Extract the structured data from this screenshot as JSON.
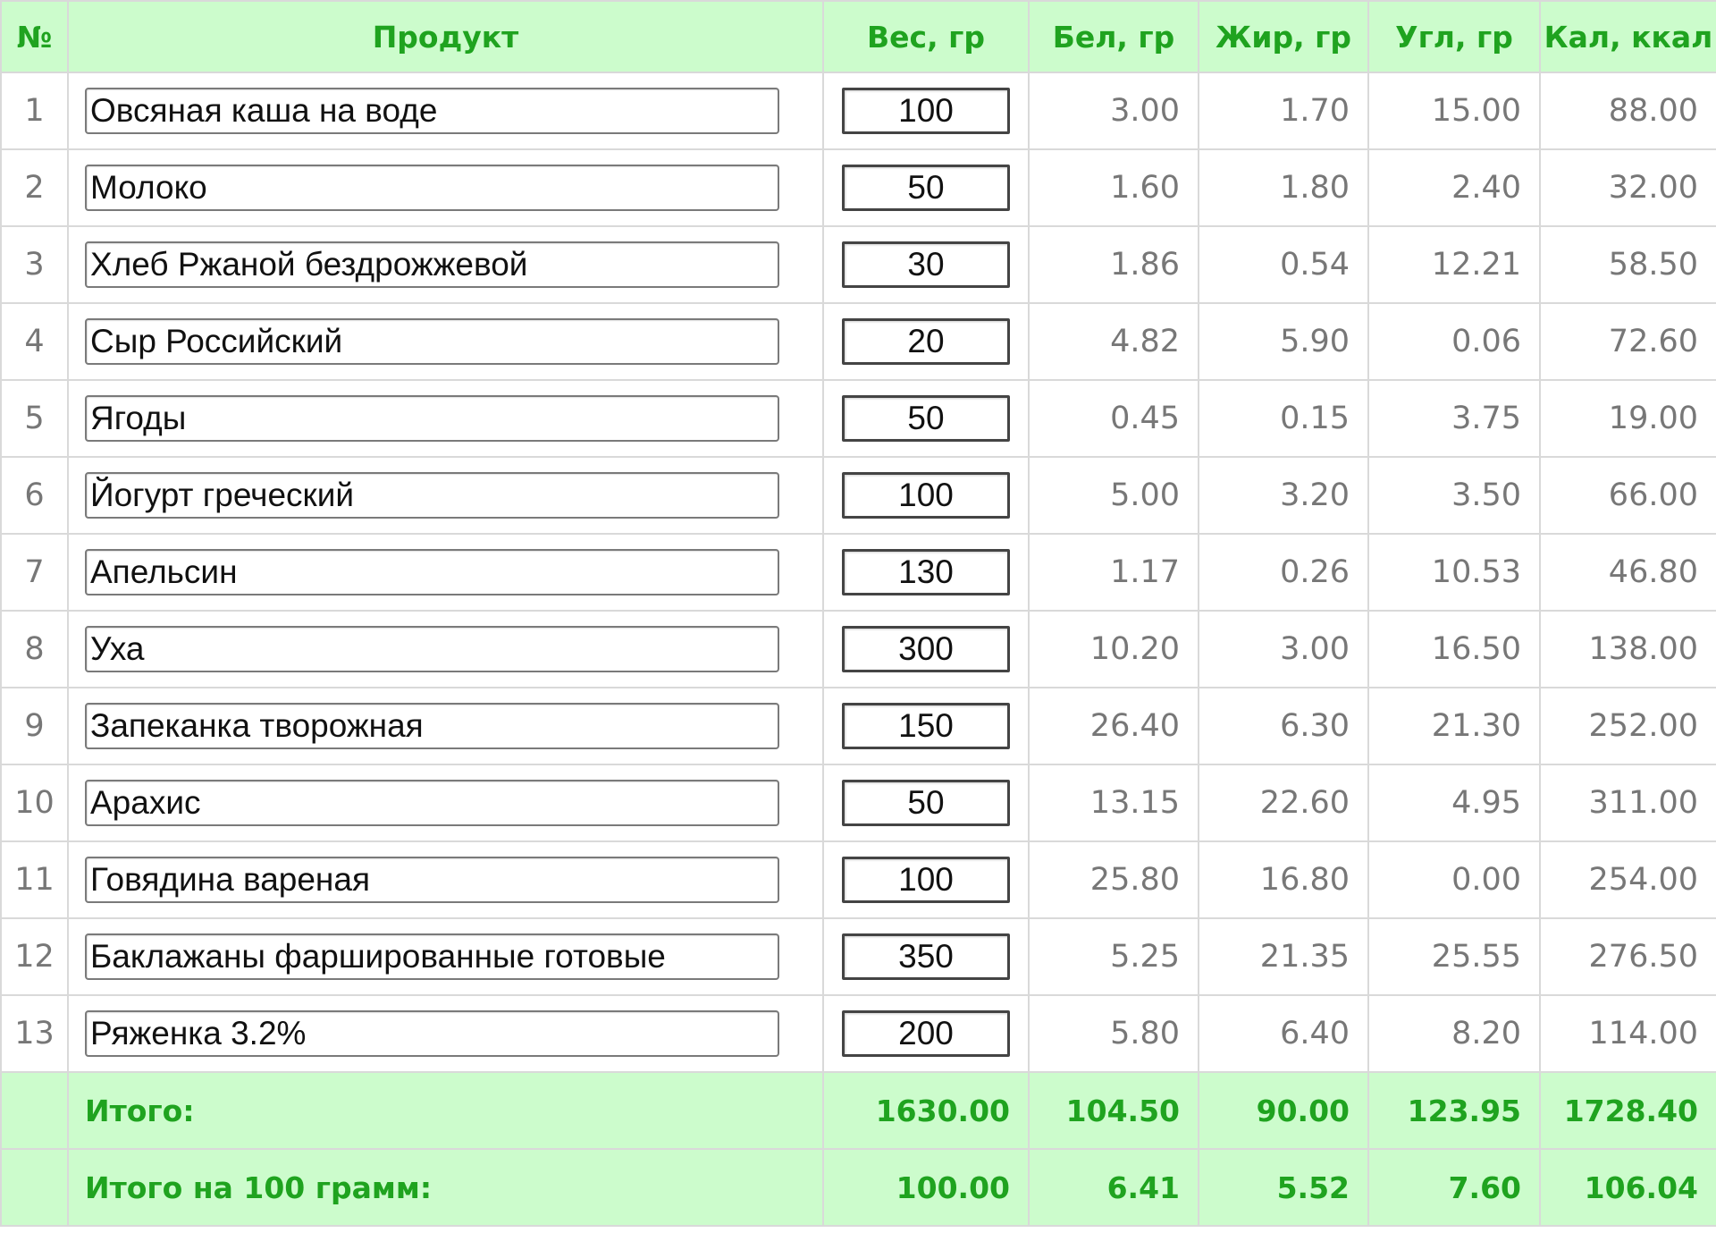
{
  "table": {
    "headers": {
      "num": "№",
      "product": "Продукт",
      "weight": "Вес, гр",
      "protein": "Бел, гр",
      "fat": "Жир, гр",
      "carbs": "Угл, гр",
      "calories": "Кал, ккал"
    },
    "rows": [
      {
        "num": "1",
        "product": "Овсяная каша на воде",
        "weight": "100",
        "protein": "3.00",
        "fat": "1.70",
        "carbs": "15.00",
        "calories": "88.00"
      },
      {
        "num": "2",
        "product": "Молоко",
        "weight": "50",
        "protein": "1.60",
        "fat": "1.80",
        "carbs": "2.40",
        "calories": "32.00"
      },
      {
        "num": "3",
        "product": "Хлеб Ржаной бездрожжевой",
        "weight": "30",
        "protein": "1.86",
        "fat": "0.54",
        "carbs": "12.21",
        "calories": "58.50"
      },
      {
        "num": "4",
        "product": "Сыр Российский",
        "weight": "20",
        "protein": "4.82",
        "fat": "5.90",
        "carbs": "0.06",
        "calories": "72.60"
      },
      {
        "num": "5",
        "product": "Ягоды",
        "weight": "50",
        "protein": "0.45",
        "fat": "0.15",
        "carbs": "3.75",
        "calories": "19.00"
      },
      {
        "num": "6",
        "product": "Йогурт греческий",
        "weight": "100",
        "protein": "5.00",
        "fat": "3.20",
        "carbs": "3.50",
        "calories": "66.00"
      },
      {
        "num": "7",
        "product": "Апельсин",
        "weight": "130",
        "protein": "1.17",
        "fat": "0.26",
        "carbs": "10.53",
        "calories": "46.80"
      },
      {
        "num": "8",
        "product": "Уха",
        "weight": "300",
        "protein": "10.20",
        "fat": "3.00",
        "carbs": "16.50",
        "calories": "138.00"
      },
      {
        "num": "9",
        "product": "Запеканка творожная",
        "weight": "150",
        "protein": "26.40",
        "fat": "6.30",
        "carbs": "21.30",
        "calories": "252.00"
      },
      {
        "num": "10",
        "product": "Арахис",
        "weight": "50",
        "protein": "13.15",
        "fat": "22.60",
        "carbs": "4.95",
        "calories": "311.00"
      },
      {
        "num": "11",
        "product": "Говядина вареная",
        "weight": "100",
        "protein": "25.80",
        "fat": "16.80",
        "carbs": "0.00",
        "calories": "254.00"
      },
      {
        "num": "12",
        "product": "Баклажаны фаршированные готовые",
        "weight": "350",
        "protein": "5.25",
        "fat": "21.35",
        "carbs": "25.55",
        "calories": "276.50"
      },
      {
        "num": "13",
        "product": "Ряженка 3.2%",
        "weight": "200",
        "protein": "5.80",
        "fat": "6.40",
        "carbs": "8.20",
        "calories": "114.00"
      }
    ],
    "totals": [
      {
        "label": "Итого:",
        "weight": "1630.00",
        "protein": "104.50",
        "fat": "90.00",
        "carbs": "123.95",
        "calories": "1728.40"
      },
      {
        "label": "Итого на 100 грамм:",
        "weight": "100.00",
        "protein": "6.41",
        "fat": "5.52",
        "carbs": "7.60",
        "calories": "106.04"
      }
    ]
  },
  "colors": {
    "header_bg": "#ccfccc",
    "header_text": "#1fa31f",
    "cell_text": "#777777",
    "border": "#d9d9d9"
  }
}
